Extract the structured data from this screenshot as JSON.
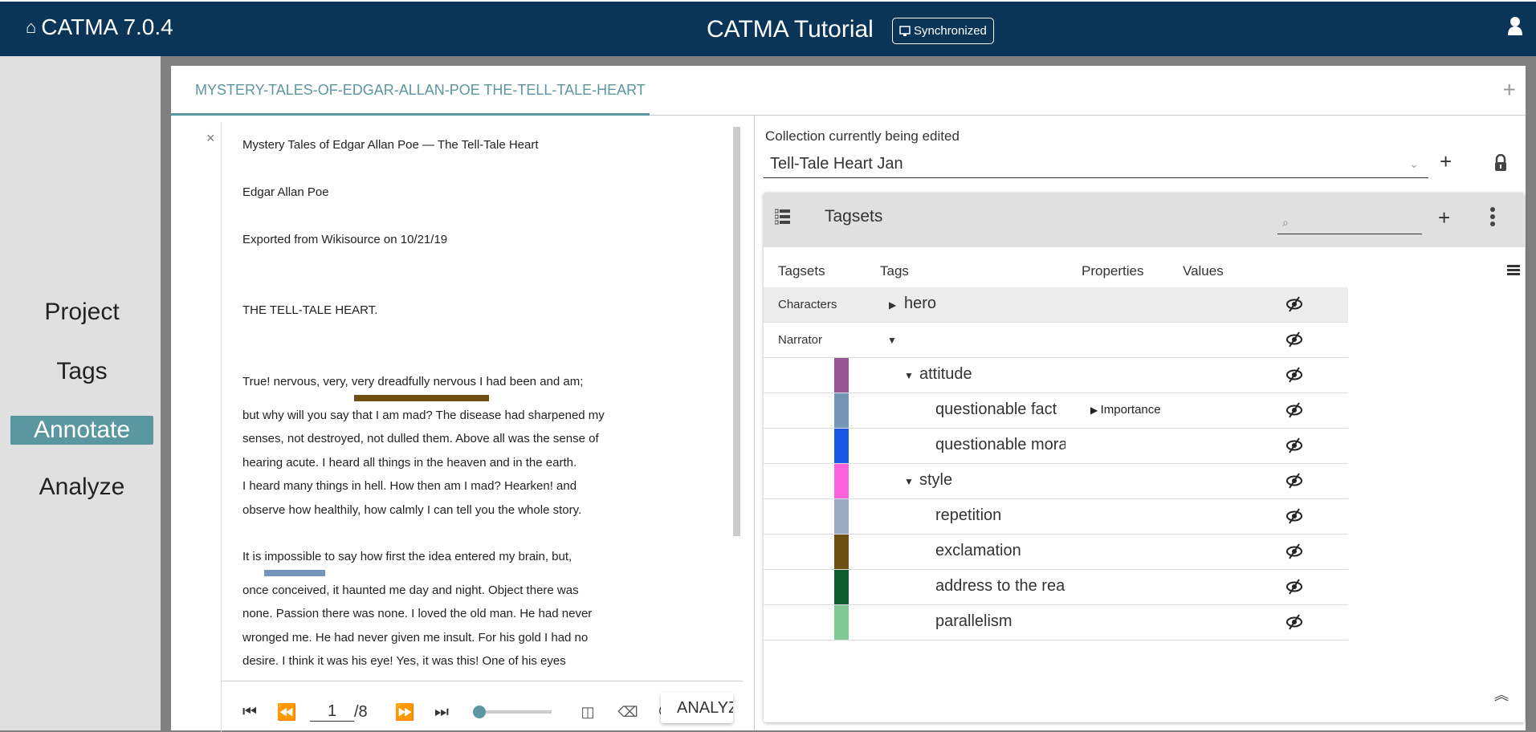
{
  "header": {
    "app_name": "CATMA 7.0.4",
    "project_title": "CATMA Tutorial",
    "sync_status": "Synchronized"
  },
  "nav": {
    "items": [
      {
        "label": "Project",
        "active": false
      },
      {
        "label": "Tags",
        "active": false
      },
      {
        "label": "Annotate",
        "active": true
      },
      {
        "label": "Analyze",
        "active": false
      }
    ]
  },
  "tabs": {
    "document_tab": "MYSTERY-TALES-OF-EDGAR-ALLAN-POE THE-TELL-TALE-HEART",
    "close_symbol": "×",
    "add_symbol": "+"
  },
  "document": {
    "lines": [
      "Mystery Tales of Edgar Allan Poe — The Tell-Tale Heart",
      "Edgar Allan Poe",
      "Exported from Wikisource on 10/21/19",
      "THE TELL-TALE HEART.",
      "True! nervous, very, very dreadfully nervous I had been and am;",
      "but why will you say that I am mad? The disease had sharpened my",
      "senses, not destroyed, not dulled them. Above all was the sense of",
      " hearing acute. I heard all things in the heaven and in the earth.",
      " I heard many things in hell. How then am I mad? Hearken! and",
      "observe how healthily, how calmly I can tell you the whole story.",
      "It is impossible to say how first the idea entered my brain, but,",
      "once conceived, it haunted me day and night. Object there was",
      "none. Passion there was none. I loved the old man. He had never",
      "wronged me. He had never given me insult. For his gold I had no",
      "desire. I think it was his eye! Yes, it was this! One of his eyes"
    ],
    "annotations": [
      {
        "text": "very dreadfully nervous",
        "tag": "exclamation",
        "color": "#6f4e12"
      },
      {
        "text": "impossible",
        "tag": "questionable fact",
        "color": "#7494b8"
      }
    ]
  },
  "pager": {
    "current_page": "1",
    "total_pages": "/8",
    "zoom_fraction": 0.0,
    "analyze_label": "ANALYZE"
  },
  "collection": {
    "label": "Collection currently being edited",
    "selected": "Tell-Tale Heart Jan"
  },
  "tagsets": {
    "title": "Tagsets",
    "search_placeholder": "⌕",
    "columns": [
      "Tagsets",
      "Tags",
      "Properties",
      "Values"
    ],
    "rows": [
      {
        "tagset": "Characters",
        "tag": "hero",
        "caret": "right",
        "level": 0,
        "color": "",
        "property": "",
        "selected": true
      },
      {
        "tagset": "Narrator",
        "tag": "",
        "caret": "down",
        "level": 0,
        "color": "",
        "property": "",
        "selected": false
      },
      {
        "tagset": "",
        "tag": "attitude",
        "caret": "down",
        "level": 1,
        "color": "#9a5594",
        "property": "",
        "selected": false
      },
      {
        "tagset": "",
        "tag": "questionable fact",
        "caret": "",
        "level": 2,
        "color": "#7494b8",
        "property": "Importance",
        "selected": false
      },
      {
        "tagset": "",
        "tag": "questionable moral",
        "caret": "",
        "level": 2,
        "color": "#1b57e6",
        "property": "",
        "selected": false
      },
      {
        "tagset": "",
        "tag": "style",
        "caret": "down",
        "level": 1,
        "color": "#fb62dc",
        "property": "",
        "selected": false
      },
      {
        "tagset": "",
        "tag": "repetition",
        "caret": "",
        "level": 2,
        "color": "#9caac4",
        "property": "",
        "selected": false
      },
      {
        "tagset": "",
        "tag": "exclamation",
        "caret": "",
        "level": 2,
        "color": "#6f4e12",
        "property": "",
        "selected": false
      },
      {
        "tagset": "",
        "tag": "address to the reader",
        "caret": "",
        "level": 2,
        "color": "#0f5c2f",
        "property": "",
        "selected": false
      },
      {
        "tagset": "",
        "tag": "parallelism",
        "caret": "",
        "level": 2,
        "color": "#81c994",
        "property": "",
        "selected": false
      }
    ]
  },
  "colors": {
    "header_bg": "#0b3558",
    "accent": "#5b97a0"
  }
}
